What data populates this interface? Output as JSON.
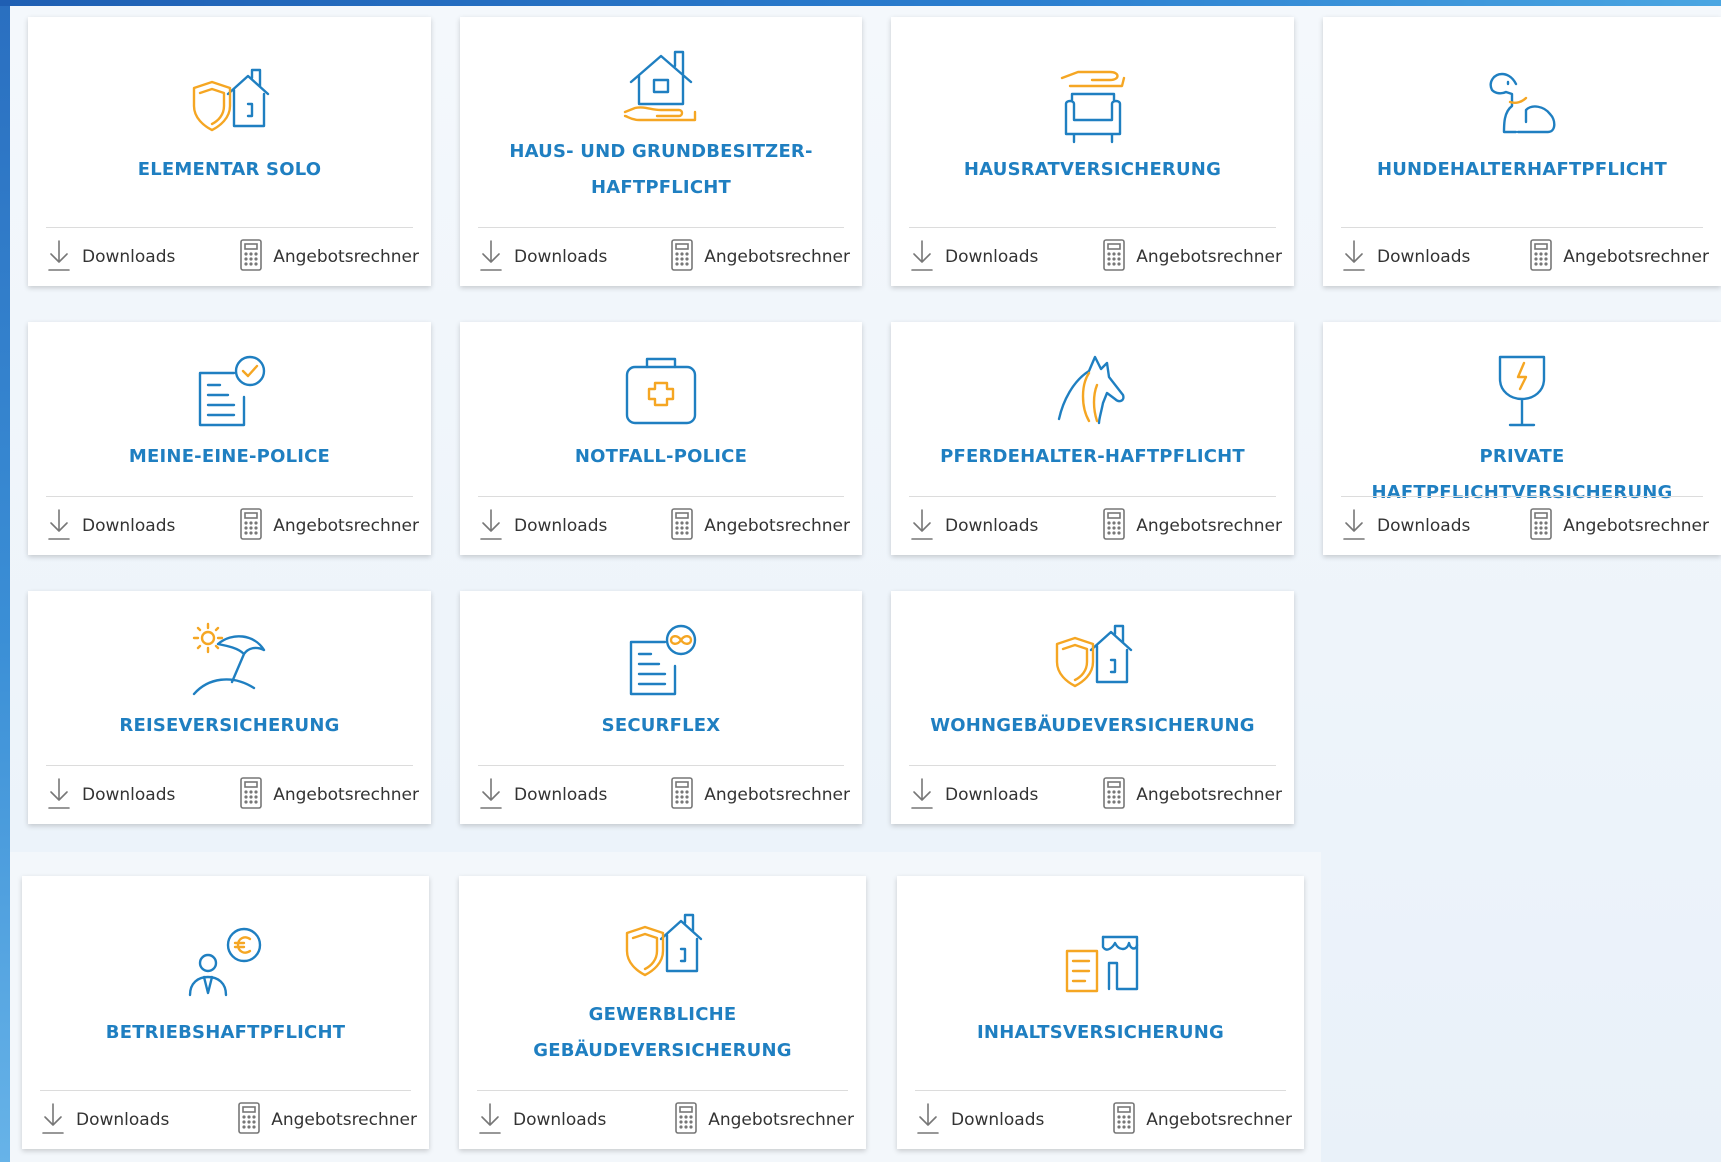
{
  "actions": {
    "downloads": "Downloads",
    "calculator": "Angebotsrechner"
  },
  "colors": {
    "accent": "#1f7fc1",
    "orange": "#f5a623"
  },
  "cards": [
    {
      "title_lines": [
        "ELEMENTAR SOLO"
      ],
      "icon": "house-shield-icon"
    },
    {
      "title_lines": [
        "HAUS- UND GRUNDBESITZER-",
        "HAFTPFLICHT"
      ],
      "icon": "house-hand-icon"
    },
    {
      "title_lines": [
        "HAUSRATVERSICHERUNG"
      ],
      "icon": "sofa-hand-icon"
    },
    {
      "title_lines": [
        "HUNDEHALTERHAFTPFLICHT"
      ],
      "icon": "dog-icon"
    },
    {
      "title_lines": [
        "MEINE-EINE-POLICE"
      ],
      "icon": "document-check-icon"
    },
    {
      "title_lines": [
        "NOTFALL-POLICE"
      ],
      "icon": "first-aid-kit-icon"
    },
    {
      "title_lines": [
        "PFERDEHALTER-HAFTPFLICHT"
      ],
      "icon": "horse-icon"
    },
    {
      "title_lines": [
        "PRIVATE HAFTPFLICHTVERSICHERUNG"
      ],
      "icon": "broken-glass-icon"
    },
    {
      "title_lines": [
        "REISEVERSICHERUNG"
      ],
      "icon": "beach-umbrella-icon"
    },
    {
      "title_lines": [
        "SECURFLEX"
      ],
      "icon": "document-infinity-icon"
    },
    {
      "title_lines": [
        "WOHNGEBÄUDEVERSICHERUNG"
      ],
      "icon": "house-shield-icon"
    },
    {
      "title_lines": [
        "BETRIEBSHAFTPFLICHT"
      ],
      "icon": "person-euro-icon"
    },
    {
      "title_lines": [
        "GEWERBLICHE",
        "GEBÄUDEVERSICHERUNG"
      ],
      "icon": "house-shield-icon"
    },
    {
      "title_lines": [
        "INHALTSVERSICHERUNG"
      ],
      "icon": "shop-icon"
    }
  ]
}
